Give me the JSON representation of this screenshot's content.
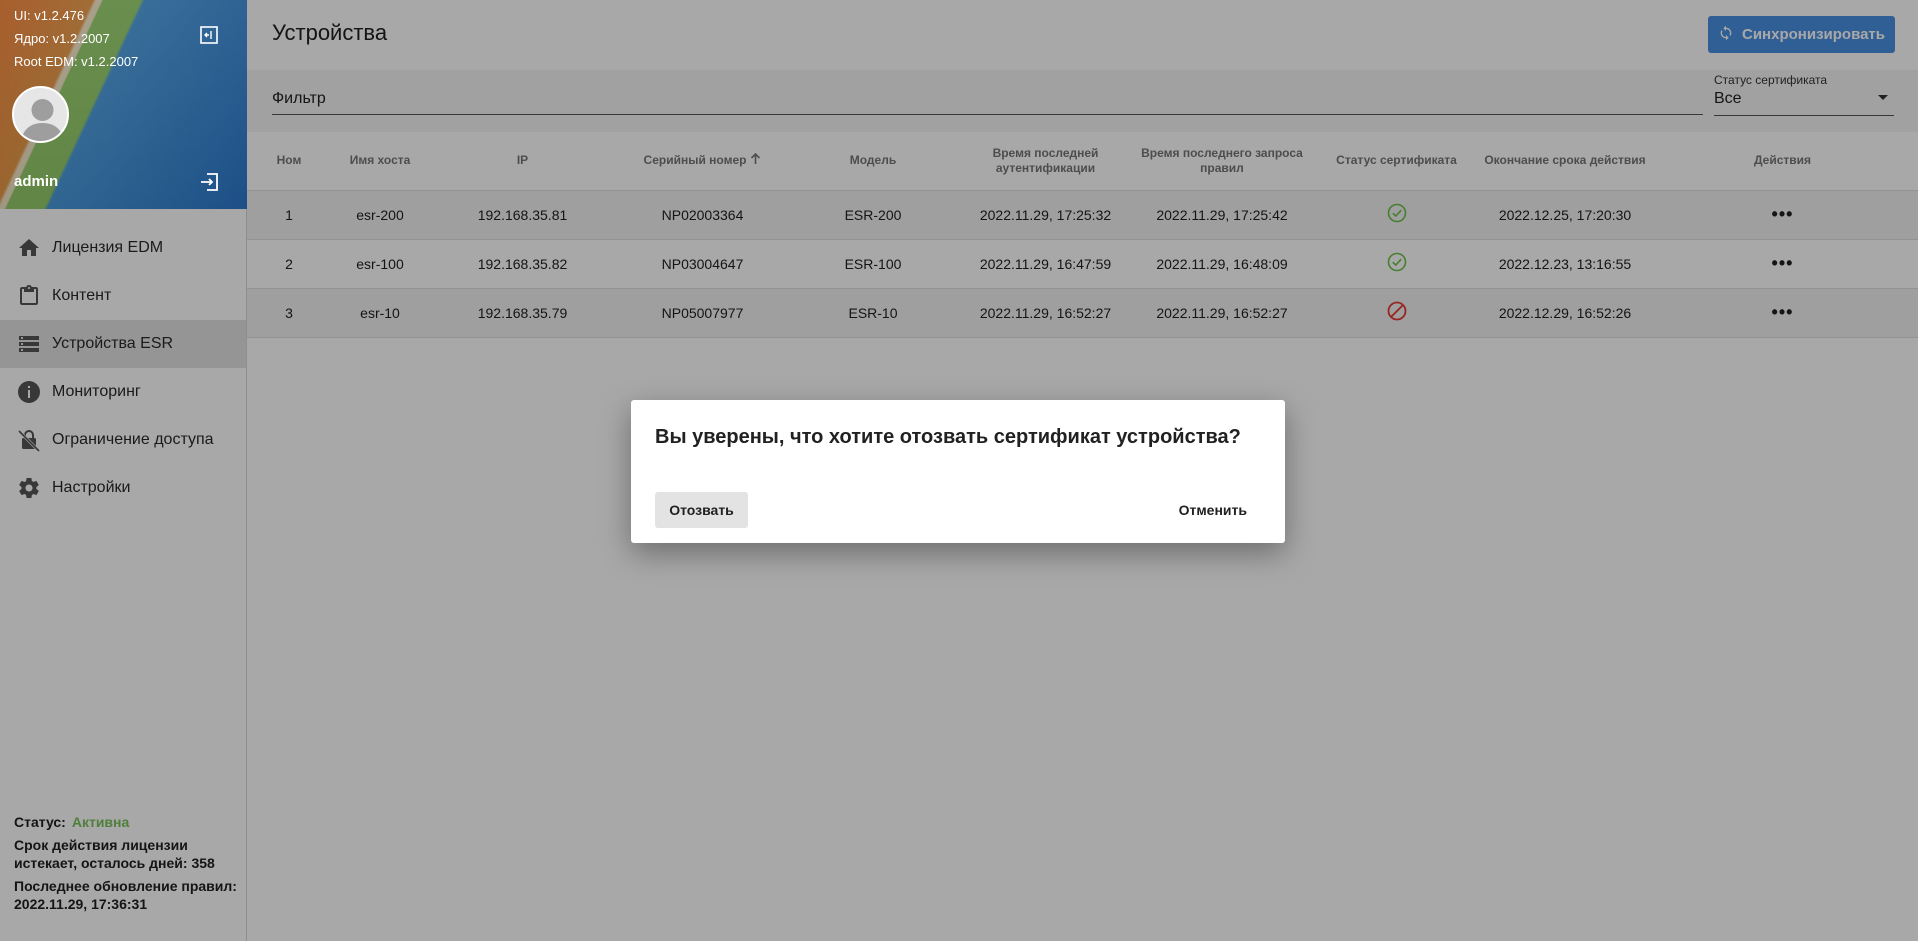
{
  "sidebar": {
    "versions": {
      "ui": "UI: v1.2.476",
      "core": "Ядро: v1.2.2007",
      "root": "Root EDM: v1.2.2007"
    },
    "username": "admin",
    "nav": [
      {
        "label": "Лицензия EDM",
        "icon": "home-icon"
      },
      {
        "label": "Контент",
        "icon": "clipboard-icon"
      },
      {
        "label": "Устройства ESR",
        "icon": "list-icon",
        "active": true
      },
      {
        "label": "Мониторинг",
        "icon": "info-icon"
      },
      {
        "label": "Ограничение доступа",
        "icon": "lock-slash-icon"
      },
      {
        "label": "Настройки",
        "icon": "gear-icon"
      }
    ],
    "license": {
      "status_label": "Статус:",
      "status_value": "Активна",
      "expiry": "Срок действия лицензии истекает, осталось дней: 358",
      "last_update": "Последнее обновление правил: 2022.11.29, 17:36:31"
    }
  },
  "header": {
    "title": "Устройства",
    "sync_label": "Синхронизировать"
  },
  "filter": {
    "placeholder": "Фильтр",
    "status_label": "Статус сертификата",
    "status_value": "Все"
  },
  "table": {
    "columns": {
      "num": "Ном",
      "host": "Имя хоста",
      "ip": "IP",
      "serial": "Серийный номер",
      "model": "Модель",
      "auth": "Время последней аутентификации",
      "rules": "Время последнего запроса правил",
      "cert": "Статус сертификата",
      "expiry": "Окончание срока действия",
      "actions": "Действия"
    },
    "rows": [
      {
        "num": "1",
        "host": "esr-200",
        "ip": "192.168.35.81",
        "serial": "NP02003364",
        "model": "ESR-200",
        "auth": "2022.11.29, 17:25:32",
        "rules": "2022.11.29, 17:25:42",
        "cert": "valid",
        "expiry": "2022.12.25, 17:20:30"
      },
      {
        "num": "2",
        "host": "esr-100",
        "ip": "192.168.35.82",
        "serial": "NP03004647",
        "model": "ESR-100",
        "auth": "2022.11.29, 16:47:59",
        "rules": "2022.11.29, 16:48:09",
        "cert": "valid",
        "expiry": "2022.12.23, 13:16:55"
      },
      {
        "num": "3",
        "host": "esr-10",
        "ip": "192.168.35.79",
        "serial": "NP05007977",
        "model": "ESR-10",
        "auth": "2022.11.29, 16:52:27",
        "rules": "2022.11.29, 16:52:27",
        "cert": "revoked",
        "expiry": "2022.12.29, 16:52:26"
      }
    ]
  },
  "dialog": {
    "question": "Вы уверены, что хотите отозвать сертификат устройства?",
    "revoke_label": "Отозвать",
    "cancel_label": "Отменить"
  },
  "colors": {
    "accent": "#4a90e2",
    "status_active": "#78c15a",
    "cert_valid": "#6cc04a",
    "cert_revoked": "#e53935"
  }
}
